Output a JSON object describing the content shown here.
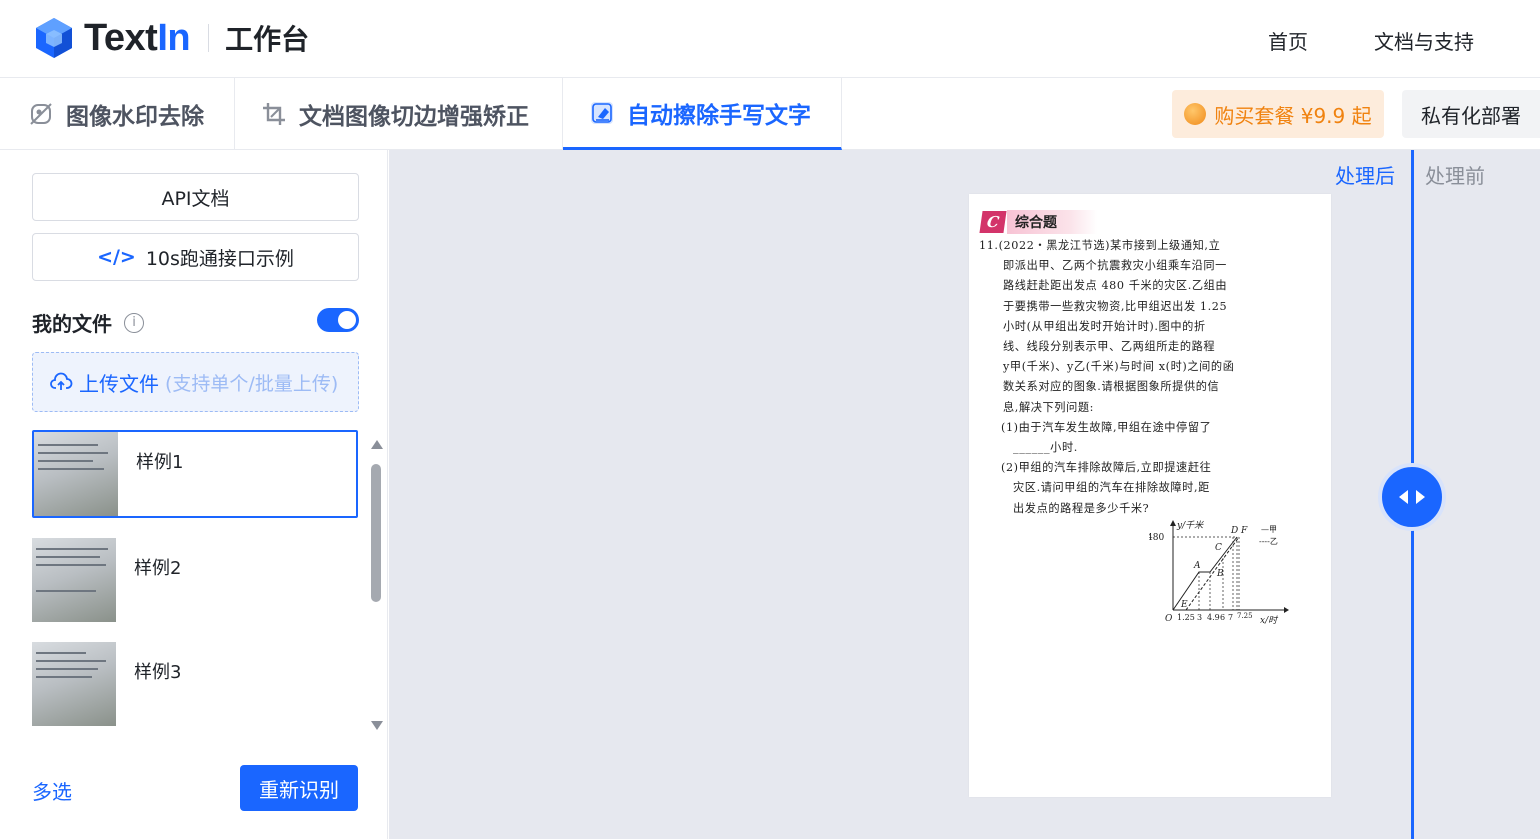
{
  "header": {
    "logo_text_a": "Text",
    "logo_text_b": "In",
    "subtitle": "工作台",
    "nav": [
      "首页",
      "文档与支持"
    ]
  },
  "tabs": [
    {
      "label": "图像水印去除",
      "icon": "watermark-remove-icon",
      "active": false
    },
    {
      "label": "文档图像切边增强矫正",
      "icon": "crop-icon",
      "active": false
    },
    {
      "label": "自动擦除手写文字",
      "icon": "eraser-icon",
      "active": true
    }
  ],
  "actions": {
    "buy_label": "购买套餐 ¥9.9 起",
    "private_label": "私有化部署"
  },
  "sidebar": {
    "api_doc": "API文档",
    "code_glyph": "</>",
    "quickstart": "10s跑通接口示例",
    "my_files": "我的文件",
    "info_glyph": "i",
    "toggle_on": true,
    "upload_label": "上传文件",
    "upload_hint": "(支持单个/批量上传)",
    "files": [
      {
        "name": "样例1",
        "selected": true
      },
      {
        "name": "样例2",
        "selected": false
      },
      {
        "name": "样例3",
        "selected": false
      }
    ],
    "multi_select": "多选",
    "re_recognize": "重新识别"
  },
  "viewer": {
    "after_label": "处理后",
    "before_label": "处理前"
  },
  "document": {
    "section_letter": "C",
    "section_title": "综合题",
    "lines": [
      "11.(2022・黑龙江节选)某市接到上级通知,立",
      "即派出甲、乙两个抗震救灾小组乘车沿同一",
      "路线赶赴距出发点 480 千米的灾区.乙组由",
      "于要携带一些救灾物资,比甲组迟出发 1.25",
      "小时(从甲组出发时开始计时).图中的折",
      "线、线段分别表示甲、乙两组所走的路程",
      "y甲(千米)、y乙(千米)与时间 x(时)之间的函",
      "数关系对应的图象.请根据图象所提供的信",
      "息,解决下列问题:",
      "(1)由于汽车发生故障,甲组在途中停留了",
      "______小时.",
      "(2)甲组的汽车排除故障后,立即提速赶往",
      "灾区.请问甲组的汽车在排除故障时,距",
      "出发点的路程是多少千米?"
    ],
    "graph": {
      "y_axis": "y/千米",
      "x_axis": "x/时",
      "y_tick": "480",
      "origin": "O",
      "x_ticks": [
        "1.25",
        "3",
        "4.9",
        "6",
        "7",
        "7.25"
      ],
      "points": [
        "A",
        "B",
        "C",
        "D",
        "E",
        "F"
      ],
      "legend": [
        "—甲",
        "----乙"
      ]
    }
  }
}
